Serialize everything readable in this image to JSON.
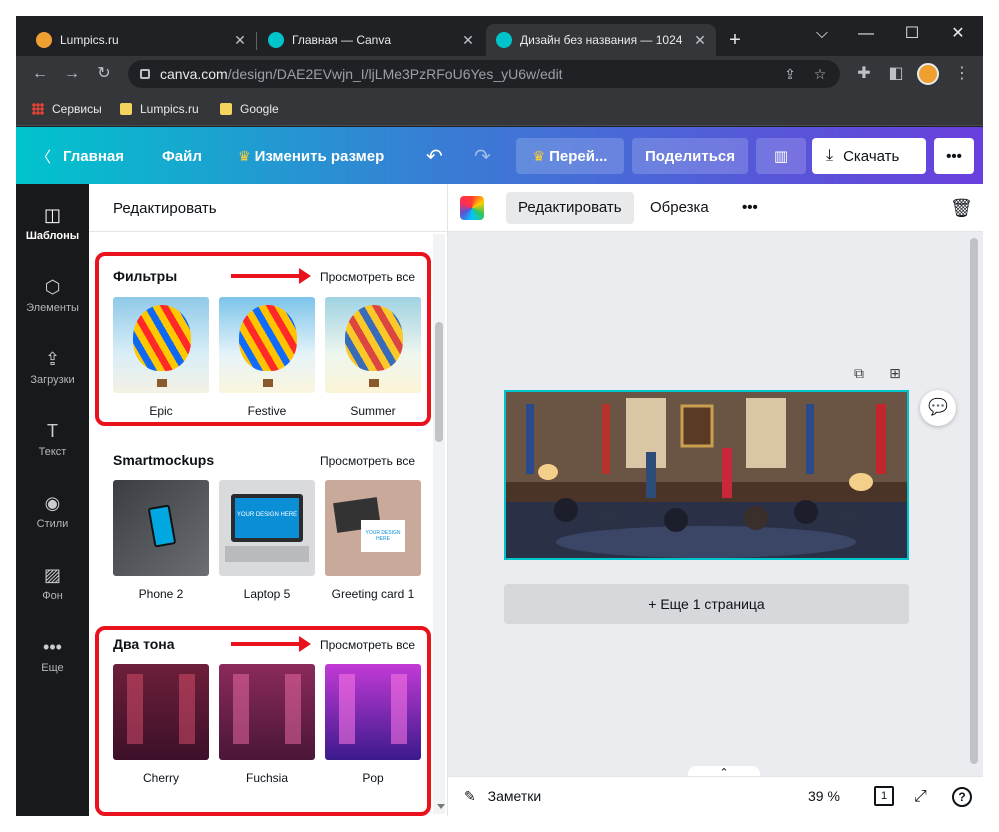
{
  "browser": {
    "tabs": [
      {
        "title": "Lumpics.ru",
        "favicon_color": "#f0a030"
      },
      {
        "title": "Главная — Canva",
        "favicon_color": "#00c4cc"
      },
      {
        "title": "Дизайн без названия — 1024",
        "favicon_color": "#00c4cc"
      }
    ],
    "new_tab_icon": "+",
    "window_controls": {
      "minimize": "—",
      "maximize": "☐",
      "close": "✕",
      "tab_search": "⌵"
    },
    "url": {
      "host": "canva.com",
      "path": "/design/DAE2EVwjn_I/ljLMe3PzRFoU6Yes_yU6w/edit"
    },
    "bookmarks": [
      "Сервисы",
      "Lumpics.ru",
      "Google"
    ]
  },
  "canva_header": {
    "home": "Главная",
    "file": "Файл",
    "resize": "Изменить размер",
    "upgrade": "Перей...",
    "share": "Поделиться",
    "download": "Скачать",
    "more": "•••"
  },
  "left_rail": [
    {
      "label": "Шаблоны",
      "icon": "templates-icon",
      "glyph": "◫"
    },
    {
      "label": "Элементы",
      "icon": "elements-icon",
      "glyph": "⬡"
    },
    {
      "label": "Загрузки",
      "icon": "upload-icon",
      "glyph": "⇪"
    },
    {
      "label": "Текст",
      "icon": "text-icon",
      "glyph": "T"
    },
    {
      "label": "Стили",
      "icon": "palette-icon",
      "glyph": "◉"
    },
    {
      "label": "Фон",
      "icon": "background-icon",
      "glyph": "▨"
    },
    {
      "label": "Еще",
      "icon": "more-icon",
      "glyph": "•••"
    }
  ],
  "panel": {
    "title": "Редактировать",
    "sections": [
      {
        "title": "Фильтры",
        "see_all": "Просмотреть все",
        "items": [
          "Epic",
          "Festive",
          "Summer"
        ]
      },
      {
        "title": "Smartmockups",
        "see_all": "Просмотреть все",
        "items": [
          "Phone 2",
          "Laptop 5",
          "Greeting card 1"
        ]
      },
      {
        "title": "Два тона",
        "see_all": "Просмотреть все",
        "items": [
          "Cherry",
          "Fuchsia",
          "Pop"
        ]
      }
    ],
    "mockup_text": "YOUR DESIGN HERE"
  },
  "editor_toolbar": {
    "edit": "Редактировать",
    "crop": "Обрезка",
    "more": "•••"
  },
  "canvas": {
    "more_pages": "+ Еще 1 страница"
  },
  "bottom_bar": {
    "notes": "Заметки",
    "zoom": "39 %",
    "page_count": "1",
    "help": "?"
  },
  "colors": {
    "annotation_red": "#e8131c",
    "selection": "#00c4cc",
    "rail_bg": "#18191b"
  }
}
